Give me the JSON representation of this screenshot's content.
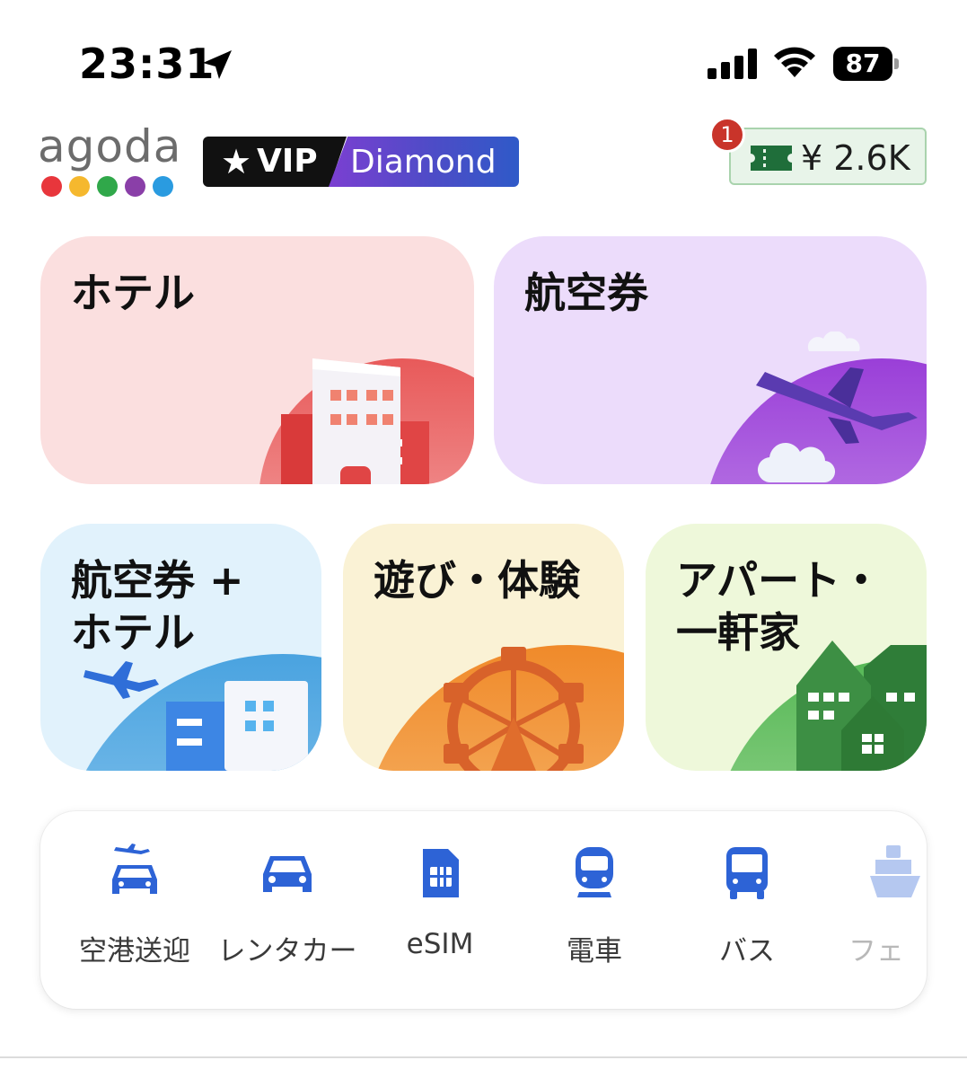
{
  "status_bar": {
    "time": "23:31",
    "battery": "87",
    "icons": [
      "location-arrow-icon",
      "cellular-signal-icon",
      "wifi-icon",
      "battery-icon"
    ]
  },
  "header": {
    "logo_text": "agoda",
    "logo_dot_colors": [
      "#e8363c",
      "#f5b82e",
      "#30a84a",
      "#8a3fa8",
      "#2a9be0"
    ],
    "vip": {
      "star": "★",
      "label": "VIP",
      "tier": "Diamond"
    },
    "wallet": {
      "amount": "¥ 2.6K",
      "notification_count": "1",
      "icon": "ticket-icon"
    }
  },
  "tiles": {
    "hotel": {
      "label": "ホテル",
      "icon": "hotel-building-icon",
      "color": "#fbdfdf"
    },
    "flight": {
      "label": "航空券",
      "icon": "airplane-icon",
      "color": "#ecdcfb"
    },
    "package": {
      "line1": "航空券 +",
      "line2": "ホテル",
      "icon": "flight-hotel-icon",
      "color": "#e1f2fc"
    },
    "activity": {
      "label": "遊び・体験",
      "icon": "ferris-wheel-icon",
      "color": "#faf2d5"
    },
    "home": {
      "line1": "アパート・",
      "line2": "一軒家",
      "icon": "houses-icon",
      "color": "#eef8da"
    }
  },
  "transport": {
    "accent": "#2d63d6",
    "items": [
      {
        "label": "空港送迎",
        "icon": "airport-transfer-icon"
      },
      {
        "label": "レンタカー",
        "icon": "car-icon"
      },
      {
        "label": "eSIM",
        "icon": "sim-card-icon"
      },
      {
        "label": "電車",
        "icon": "train-icon"
      },
      {
        "label": "バス",
        "icon": "bus-icon"
      },
      {
        "label": "フェ",
        "icon": "ferry-icon"
      }
    ]
  }
}
